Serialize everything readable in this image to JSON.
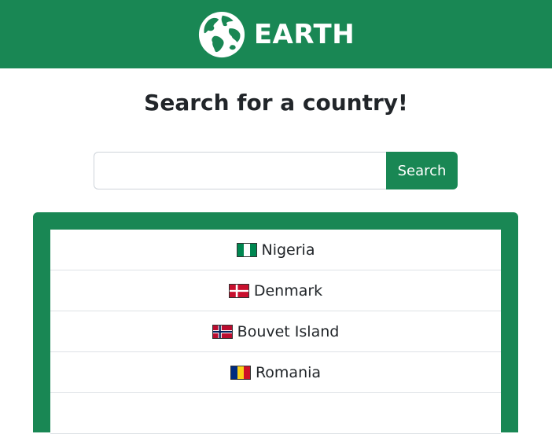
{
  "header": {
    "brand_text": "EARTH",
    "logo_icon": "globe-icon",
    "background_color": "#198754"
  },
  "main": {
    "title": "Search for a country!"
  },
  "search": {
    "value": "",
    "placeholder": "",
    "button_label": "Search"
  },
  "results": {
    "items": [
      {
        "name": "Nigeria",
        "flag_icon": "flag-nigeria-icon"
      },
      {
        "name": "Denmark",
        "flag_icon": "flag-denmark-icon"
      },
      {
        "name": "Bouvet Island",
        "flag_icon": "flag-bouvet-island-icon"
      },
      {
        "name": "Romania",
        "flag_icon": "flag-romania-icon"
      }
    ]
  },
  "colors": {
    "accent": "#198754",
    "text": "#212529"
  }
}
